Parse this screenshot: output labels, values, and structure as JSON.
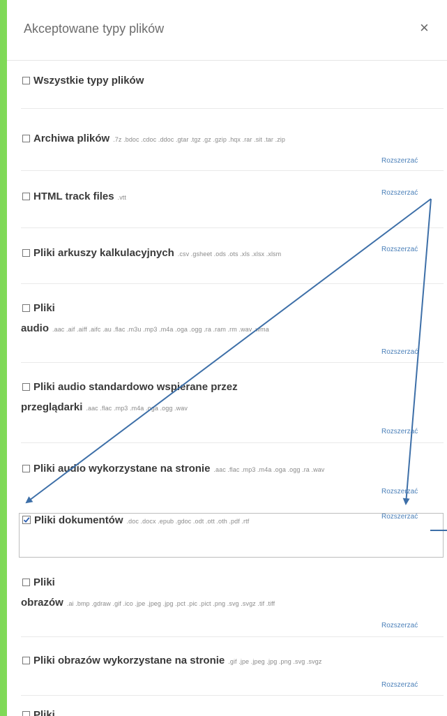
{
  "dialog": {
    "title": "Akceptowane typy plików",
    "close_label": "×"
  },
  "groups": [
    {
      "title": "Wszystkie typy plików",
      "title2": "",
      "extensions": "",
      "expand_label": "",
      "checked": false
    },
    {
      "title": "Archiwa plików",
      "title2": "",
      "extensions": ".7z .bdoc .cdoc .ddoc .gtar .tgz .gz .gzip .hqx .rar .sit .tar .zip",
      "expand_label": "Rozszerzać",
      "checked": false
    },
    {
      "title": "HTML track files",
      "title2": "",
      "extensions": ".vtt",
      "expand_label": "Rozszerzać",
      "checked": false
    },
    {
      "title": "Pliki arkuszy kalkulacyjnych",
      "title2": "",
      "extensions": ".csv .gsheet .ods .ots .xls .xlsx .xlsm",
      "expand_label": "Rozszerzać",
      "checked": false
    },
    {
      "title": "Pliki",
      "title2": "audio",
      "extensions": ".aac .aif .aiff .aifc .au .flac .m3u .mp3 .m4a .oga .ogg .ra .ram .rm .wav .wma",
      "expand_label": "Rozszerzać",
      "checked": false
    },
    {
      "title": "Pliki audio standardowo wspierane przez",
      "title2": "przeglądarki",
      "extensions": ".aac .flac .mp3 .m4a .oga .ogg .wav",
      "expand_label": "Rozszerzać",
      "checked": false
    },
    {
      "title": "Pliki audio wykorzystane na stronie",
      "title2": "",
      "extensions": ".aac .flac .mp3 .m4a .oga .ogg .ra .wav",
      "expand_label": "Rozszerzać",
      "checked": false
    },
    {
      "title": "Pliki dokumentów",
      "title2": "",
      "extensions": ".doc .docx .epub .gdoc .odt .ott .oth .pdf .rtf",
      "expand_label": "Rozszerzać",
      "checked": true
    },
    {
      "title": "Pliki",
      "title2": "obrazów",
      "extensions": ".ai .bmp .gdraw .gif .ico .jpe .jpeg .jpg .pct .pic .pict .png .svg .svgz .tif .tiff",
      "expand_label": "Rozszerzać",
      "checked": false
    },
    {
      "title": "Pliki obrazów wykorzystane na stronie",
      "title2": "",
      "extensions": ".gif .jpe .jpeg .jpg .png .svg .svgz",
      "expand_label": "Rozszerzać",
      "checked": false
    },
    {
      "title": "Pliki",
      "title2": "",
      "extensions": "",
      "expand_label": "",
      "checked": false
    }
  ],
  "colors": {
    "accent_link": "#4a7fb8",
    "annotation_arrow": "#3d6fa8",
    "checkmark": "#2a5db0"
  }
}
